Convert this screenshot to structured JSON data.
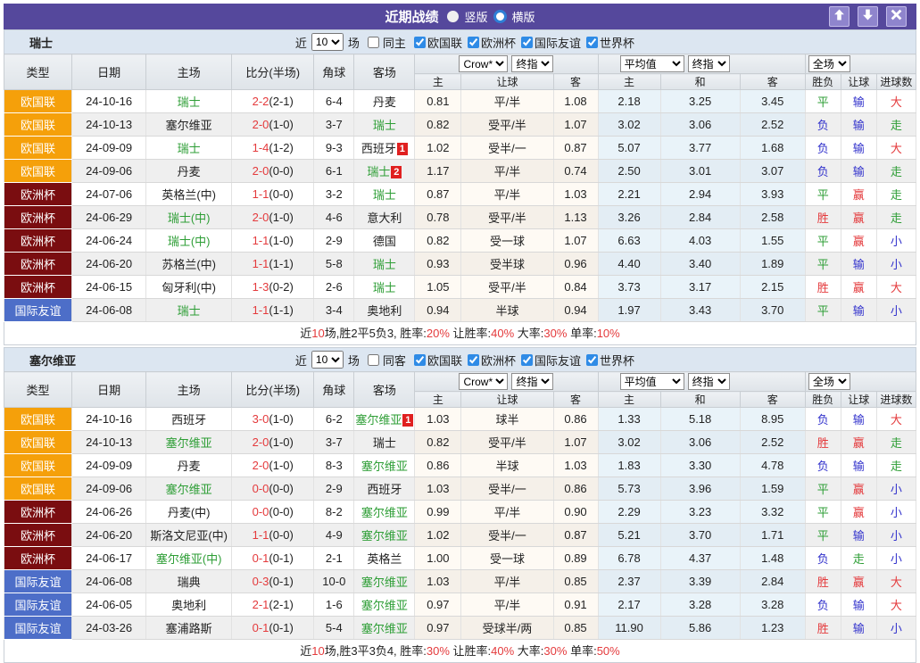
{
  "titlebar": {
    "title": "近期战绩",
    "radio_vertical": "竖版",
    "radio_horizontal": "横版",
    "buttons": [
      "up-arrow",
      "down-arrow",
      "close"
    ]
  },
  "filters": {
    "near_label": "近",
    "count_value": "10",
    "games_label": "场",
    "comps": [
      "欧国联",
      "欧洲杯",
      "国际友谊",
      "世界杯"
    ]
  },
  "table_headers": {
    "cols": [
      "类型",
      "日期",
      "主场",
      "比分(半场)",
      "角球",
      "客场"
    ],
    "odds_sub": [
      "主",
      "让球",
      "客"
    ],
    "avg_sub": [
      "主",
      "和",
      "客"
    ],
    "result_cols": [
      "胜负",
      "让球",
      "进球数"
    ],
    "select_odds": "Crow*",
    "select_final1": "终指",
    "select_avg": "平均值",
    "select_final2": "终指",
    "select_fulltime": "全场"
  },
  "type_colors": {
    "欧国联": "#F5A00A",
    "欧洲杯": "#7A0D10",
    "国际友谊": "#4D6EC8"
  },
  "result_colors": {
    "win": "#E43A3C",
    "draw": "#2E9E36",
    "loss": "#3333CC"
  },
  "sections": [
    {
      "key": "switzerland",
      "team": "瑞士",
      "same_label": "同主",
      "rows": [
        {
          "type": "欧国联",
          "tc": "o",
          "date": "24-10-16",
          "home": "瑞士",
          "hhl": 1,
          "score": "2-2",
          "half": "(2-1)",
          "corner": "6-4",
          "away": "丹麦",
          "ahl": 0,
          "ab": "",
          "odds": [
            "0.81",
            "平/半",
            "1.08"
          ],
          "avg": [
            "2.18",
            "3.25",
            "3.45"
          ],
          "res": [
            [
              "平",
              "g"
            ],
            [
              "输",
              "b"
            ],
            [
              "大",
              "r"
            ]
          ]
        },
        {
          "type": "欧国联",
          "tc": "o",
          "date": "24-10-13",
          "home": "塞尔维亚",
          "hhl": 0,
          "score": "2-0",
          "half": "(1-0)",
          "corner": "3-7",
          "away": "瑞士",
          "ahl": 1,
          "ab": "",
          "odds": [
            "0.82",
            "受平/半",
            "1.07"
          ],
          "avg": [
            "3.02",
            "3.06",
            "2.52"
          ],
          "res": [
            [
              "负",
              "b"
            ],
            [
              "输",
              "b"
            ],
            [
              "走",
              "g"
            ]
          ]
        },
        {
          "type": "欧国联",
          "tc": "o",
          "date": "24-09-09",
          "home": "瑞士",
          "hhl": 1,
          "score": "1-4",
          "half": "(1-2)",
          "corner": "9-3",
          "away": "西班牙",
          "ahl": 0,
          "ab": "1",
          "odds": [
            "1.02",
            "受半/一",
            "0.87"
          ],
          "avg": [
            "5.07",
            "3.77",
            "1.68"
          ],
          "res": [
            [
              "负",
              "b"
            ],
            [
              "输",
              "b"
            ],
            [
              "大",
              "r"
            ]
          ]
        },
        {
          "type": "欧国联",
          "tc": "o",
          "date": "24-09-06",
          "home": "丹麦",
          "hhl": 0,
          "score": "2-0",
          "half": "(0-0)",
          "corner": "6-1",
          "away": "瑞士",
          "ahl": 1,
          "ab": "2",
          "odds": [
            "1.17",
            "平/半",
            "0.74"
          ],
          "avg": [
            "2.50",
            "3.01",
            "3.07"
          ],
          "res": [
            [
              "负",
              "b"
            ],
            [
              "输",
              "b"
            ],
            [
              "走",
              "g"
            ]
          ]
        },
        {
          "type": "欧洲杯",
          "tc": "m",
          "date": "24-07-06",
          "home": "英格兰(中)",
          "hhl": 0,
          "score": "1-1",
          "half": "(0-0)",
          "corner": "3-2",
          "away": "瑞士",
          "ahl": 1,
          "ab": "",
          "odds": [
            "0.87",
            "平/半",
            "1.03"
          ],
          "avg": [
            "2.21",
            "2.94",
            "3.93"
          ],
          "res": [
            [
              "平",
              "g"
            ],
            [
              "赢",
              "r"
            ],
            [
              "走",
              "g"
            ]
          ]
        },
        {
          "type": "欧洲杯",
          "tc": "m",
          "date": "24-06-29",
          "home": "瑞士(中)",
          "hhl": 1,
          "score": "2-0",
          "half": "(1-0)",
          "corner": "4-6",
          "away": "意大利",
          "ahl": 0,
          "ab": "",
          "odds": [
            "0.78",
            "受平/半",
            "1.13"
          ],
          "avg": [
            "3.26",
            "2.84",
            "2.58"
          ],
          "res": [
            [
              "胜",
              "r"
            ],
            [
              "赢",
              "r"
            ],
            [
              "走",
              "g"
            ]
          ]
        },
        {
          "type": "欧洲杯",
          "tc": "m",
          "date": "24-06-24",
          "home": "瑞士(中)",
          "hhl": 1,
          "score": "1-1",
          "half": "(1-0)",
          "corner": "2-9",
          "away": "德国",
          "ahl": 0,
          "ab": "",
          "odds": [
            "0.82",
            "受一球",
            "1.07"
          ],
          "avg": [
            "6.63",
            "4.03",
            "1.55"
          ],
          "res": [
            [
              "平",
              "g"
            ],
            [
              "赢",
              "r"
            ],
            [
              "小",
              "b"
            ]
          ]
        },
        {
          "type": "欧洲杯",
          "tc": "m",
          "date": "24-06-20",
          "home": "苏格兰(中)",
          "hhl": 0,
          "score": "1-1",
          "half": "(1-1)",
          "corner": "5-8",
          "away": "瑞士",
          "ahl": 1,
          "ab": "",
          "odds": [
            "0.93",
            "受半球",
            "0.96"
          ],
          "avg": [
            "4.40",
            "3.40",
            "1.89"
          ],
          "res": [
            [
              "平",
              "g"
            ],
            [
              "输",
              "b"
            ],
            [
              "小",
              "b"
            ]
          ]
        },
        {
          "type": "欧洲杯",
          "tc": "m",
          "date": "24-06-15",
          "home": "匈牙利(中)",
          "hhl": 0,
          "score": "1-3",
          "half": "(0-2)",
          "corner": "2-6",
          "away": "瑞士",
          "ahl": 1,
          "ab": "",
          "odds": [
            "1.05",
            "受平/半",
            "0.84"
          ],
          "avg": [
            "3.73",
            "3.17",
            "2.15"
          ],
          "res": [
            [
              "胜",
              "r"
            ],
            [
              "赢",
              "r"
            ],
            [
              "大",
              "r"
            ]
          ]
        },
        {
          "type": "国际友谊",
          "tc": "b",
          "date": "24-06-08",
          "home": "瑞士",
          "hhl": 1,
          "score": "1-1",
          "half": "(1-1)",
          "corner": "3-4",
          "away": "奥地利",
          "ahl": 0,
          "ab": "",
          "odds": [
            "0.94",
            "半球",
            "0.94"
          ],
          "avg": [
            "1.97",
            "3.43",
            "3.70"
          ],
          "res": [
            [
              "平",
              "g"
            ],
            [
              "输",
              "b"
            ],
            [
              "小",
              "b"
            ]
          ]
        }
      ],
      "summary": [
        {
          "t": "近",
          "hl": 0
        },
        {
          "t": "10",
          "hl": 1
        },
        {
          "t": "场,胜2平5负3, 胜率:",
          "hl": 0
        },
        {
          "t": "20%",
          "hl": 1
        },
        {
          "t": " 让胜率:",
          "hl": 0
        },
        {
          "t": "40%",
          "hl": 1
        },
        {
          "t": " 大率:",
          "hl": 0
        },
        {
          "t": "30%",
          "hl": 1
        },
        {
          "t": " 单率:",
          "hl": 0
        },
        {
          "t": "10%",
          "hl": 1
        }
      ]
    },
    {
      "key": "serbia",
      "team": "塞尔维亚",
      "same_label": "同客",
      "rows": [
        {
          "type": "欧国联",
          "tc": "o",
          "date": "24-10-16",
          "home": "西班牙",
          "hhl": 0,
          "score": "3-0",
          "half": "(1-0)",
          "corner": "6-2",
          "away": "塞尔维亚",
          "ahl": 1,
          "ab": "1",
          "odds": [
            "1.03",
            "球半",
            "0.86"
          ],
          "avg": [
            "1.33",
            "5.18",
            "8.95"
          ],
          "res": [
            [
              "负",
              "b"
            ],
            [
              "输",
              "b"
            ],
            [
              "大",
              "r"
            ]
          ]
        },
        {
          "type": "欧国联",
          "tc": "o",
          "date": "24-10-13",
          "home": "塞尔维亚",
          "hhl": 1,
          "score": "2-0",
          "half": "(1-0)",
          "corner": "3-7",
          "away": "瑞士",
          "ahl": 0,
          "ab": "",
          "odds": [
            "0.82",
            "受平/半",
            "1.07"
          ],
          "avg": [
            "3.02",
            "3.06",
            "2.52"
          ],
          "res": [
            [
              "胜",
              "r"
            ],
            [
              "赢",
              "r"
            ],
            [
              "走",
              "g"
            ]
          ]
        },
        {
          "type": "欧国联",
          "tc": "o",
          "date": "24-09-09",
          "home": "丹麦",
          "hhl": 0,
          "score": "2-0",
          "half": "(1-0)",
          "corner": "8-3",
          "away": "塞尔维亚",
          "ahl": 1,
          "ab": "",
          "odds": [
            "0.86",
            "半球",
            "1.03"
          ],
          "avg": [
            "1.83",
            "3.30",
            "4.78"
          ],
          "res": [
            [
              "负",
              "b"
            ],
            [
              "输",
              "b"
            ],
            [
              "走",
              "g"
            ]
          ]
        },
        {
          "type": "欧国联",
          "tc": "o",
          "date": "24-09-06",
          "home": "塞尔维亚",
          "hhl": 1,
          "score": "0-0",
          "half": "(0-0)",
          "corner": "2-9",
          "away": "西班牙",
          "ahl": 0,
          "ab": "",
          "odds": [
            "1.03",
            "受半/一",
            "0.86"
          ],
          "avg": [
            "5.73",
            "3.96",
            "1.59"
          ],
          "res": [
            [
              "平",
              "g"
            ],
            [
              "赢",
              "r"
            ],
            [
              "小",
              "b"
            ]
          ]
        },
        {
          "type": "欧洲杯",
          "tc": "m",
          "date": "24-06-26",
          "home": "丹麦(中)",
          "hhl": 0,
          "score": "0-0",
          "half": "(0-0)",
          "corner": "8-2",
          "away": "塞尔维亚",
          "ahl": 1,
          "ab": "",
          "odds": [
            "0.99",
            "平/半",
            "0.90"
          ],
          "avg": [
            "2.29",
            "3.23",
            "3.32"
          ],
          "res": [
            [
              "平",
              "g"
            ],
            [
              "赢",
              "r"
            ],
            [
              "小",
              "b"
            ]
          ]
        },
        {
          "type": "欧洲杯",
          "tc": "m",
          "date": "24-06-20",
          "home": "斯洛文尼亚(中)",
          "hhl": 0,
          "score": "1-1",
          "half": "(0-0)",
          "corner": "4-9",
          "away": "塞尔维亚",
          "ahl": 1,
          "ab": "",
          "odds": [
            "1.02",
            "受半/一",
            "0.87"
          ],
          "avg": [
            "5.21",
            "3.70",
            "1.71"
          ],
          "res": [
            [
              "平",
              "g"
            ],
            [
              "输",
              "b"
            ],
            [
              "小",
              "b"
            ]
          ]
        },
        {
          "type": "欧洲杯",
          "tc": "m",
          "date": "24-06-17",
          "home": "塞尔维亚(中)",
          "hhl": 1,
          "score": "0-1",
          "half": "(0-1)",
          "corner": "2-1",
          "away": "英格兰",
          "ahl": 0,
          "ab": "",
          "odds": [
            "1.00",
            "受一球",
            "0.89"
          ],
          "avg": [
            "6.78",
            "4.37",
            "1.48"
          ],
          "res": [
            [
              "负",
              "b"
            ],
            [
              "走",
              "g"
            ],
            [
              "小",
              "b"
            ]
          ]
        },
        {
          "type": "国际友谊",
          "tc": "b",
          "date": "24-06-08",
          "home": "瑞典",
          "hhl": 0,
          "score": "0-3",
          "half": "(0-1)",
          "corner": "10-0",
          "away": "塞尔维亚",
          "ahl": 1,
          "ab": "",
          "odds": [
            "1.03",
            "平/半",
            "0.85"
          ],
          "avg": [
            "2.37",
            "3.39",
            "2.84"
          ],
          "res": [
            [
              "胜",
              "r"
            ],
            [
              "赢",
              "r"
            ],
            [
              "大",
              "r"
            ]
          ]
        },
        {
          "type": "国际友谊",
          "tc": "b",
          "date": "24-06-05",
          "home": "奥地利",
          "hhl": 0,
          "score": "2-1",
          "half": "(2-1)",
          "corner": "1-6",
          "away": "塞尔维亚",
          "ahl": 1,
          "ab": "",
          "odds": [
            "0.97",
            "平/半",
            "0.91"
          ],
          "avg": [
            "2.17",
            "3.28",
            "3.28"
          ],
          "res": [
            [
              "负",
              "b"
            ],
            [
              "输",
              "b"
            ],
            [
              "大",
              "r"
            ]
          ]
        },
        {
          "type": "国际友谊",
          "tc": "b",
          "date": "24-03-26",
          "home": "塞浦路斯",
          "hhl": 0,
          "score": "0-1",
          "half": "(0-1)",
          "corner": "5-4",
          "away": "塞尔维亚",
          "ahl": 1,
          "ab": "",
          "odds": [
            "0.97",
            "受球半/两",
            "0.85"
          ],
          "avg": [
            "11.90",
            "5.86",
            "1.23"
          ],
          "res": [
            [
              "胜",
              "r"
            ],
            [
              "输",
              "b"
            ],
            [
              "小",
              "b"
            ]
          ]
        }
      ],
      "summary": [
        {
          "t": "近",
          "hl": 0
        },
        {
          "t": "10",
          "hl": 1
        },
        {
          "t": "场,胜3平3负4, 胜率:",
          "hl": 0
        },
        {
          "t": "30%",
          "hl": 1
        },
        {
          "t": " 让胜率:",
          "hl": 0
        },
        {
          "t": "40%",
          "hl": 1
        },
        {
          "t": " 大率:",
          "hl": 0
        },
        {
          "t": "30%",
          "hl": 1
        },
        {
          "t": " 单率:",
          "hl": 0
        },
        {
          "t": "50%",
          "hl": 1
        }
      ]
    }
  ]
}
